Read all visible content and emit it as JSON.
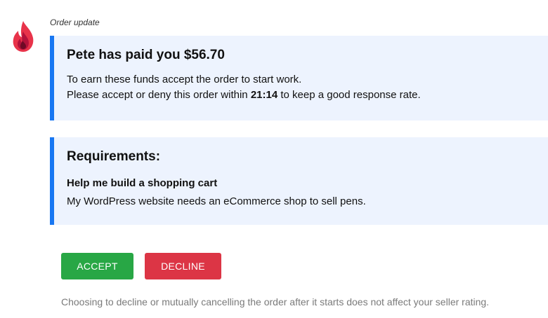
{
  "message": {
    "label": "Order update",
    "logo_icon": "flame-icon",
    "accent_color": "#1877f2",
    "panel_background": "#edf3fe"
  },
  "payment": {
    "heading": "Pete has paid you $56.70",
    "line1": "To earn these funds accept the order to start work.",
    "line2_prefix": "Please accept or deny this order within ",
    "countdown": "21:14",
    "line2_suffix": " to keep a good response rate."
  },
  "requirements": {
    "heading": "Requirements:",
    "title": "Help me build a shopping cart",
    "description": "My WordPress website needs an eCommerce shop to sell pens."
  },
  "actions": {
    "accept_label": "ACCEPT",
    "accept_color": "#28a745",
    "decline_label": "DECLINE",
    "decline_color": "#dc3545"
  },
  "footnote": "Choosing to decline or mutually cancelling the order after it starts does not affect your seller rating."
}
